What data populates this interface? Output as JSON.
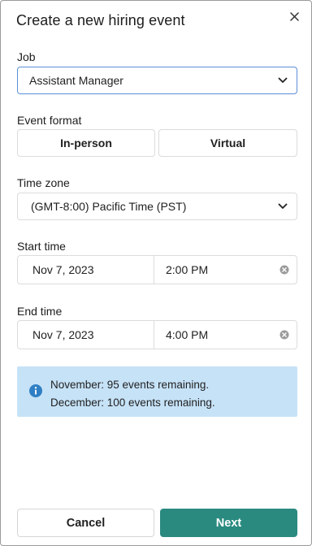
{
  "dialog": {
    "title": "Create a new hiring event",
    "close_icon": "close-icon"
  },
  "job": {
    "label": "Job",
    "selected": "Assistant Manager",
    "icon": "chevron-down-icon"
  },
  "event_format": {
    "label": "Event format",
    "options": [
      "In-person",
      "Virtual"
    ]
  },
  "time_zone": {
    "label": "Time zone",
    "selected": "(GMT-8:00) Pacific Time (PST)",
    "icon": "chevron-down-icon"
  },
  "start_time": {
    "label": "Start time",
    "date": "Nov 7, 2023",
    "time": "2:00 PM",
    "clear_icon": "clear-icon"
  },
  "end_time": {
    "label": "End time",
    "date": "Nov 7, 2023",
    "time": "4:00 PM",
    "clear_icon": "clear-icon"
  },
  "info_banner": {
    "icon": "info-icon",
    "lines": [
      "November: 95 events remaining.",
      "December: 100 events remaining."
    ],
    "background": "#c6e2f7",
    "icon_color": "#2f7fc4"
  },
  "actions": {
    "cancel_label": "Cancel",
    "next_label": "Next",
    "primary_color": "#2a8a80"
  }
}
